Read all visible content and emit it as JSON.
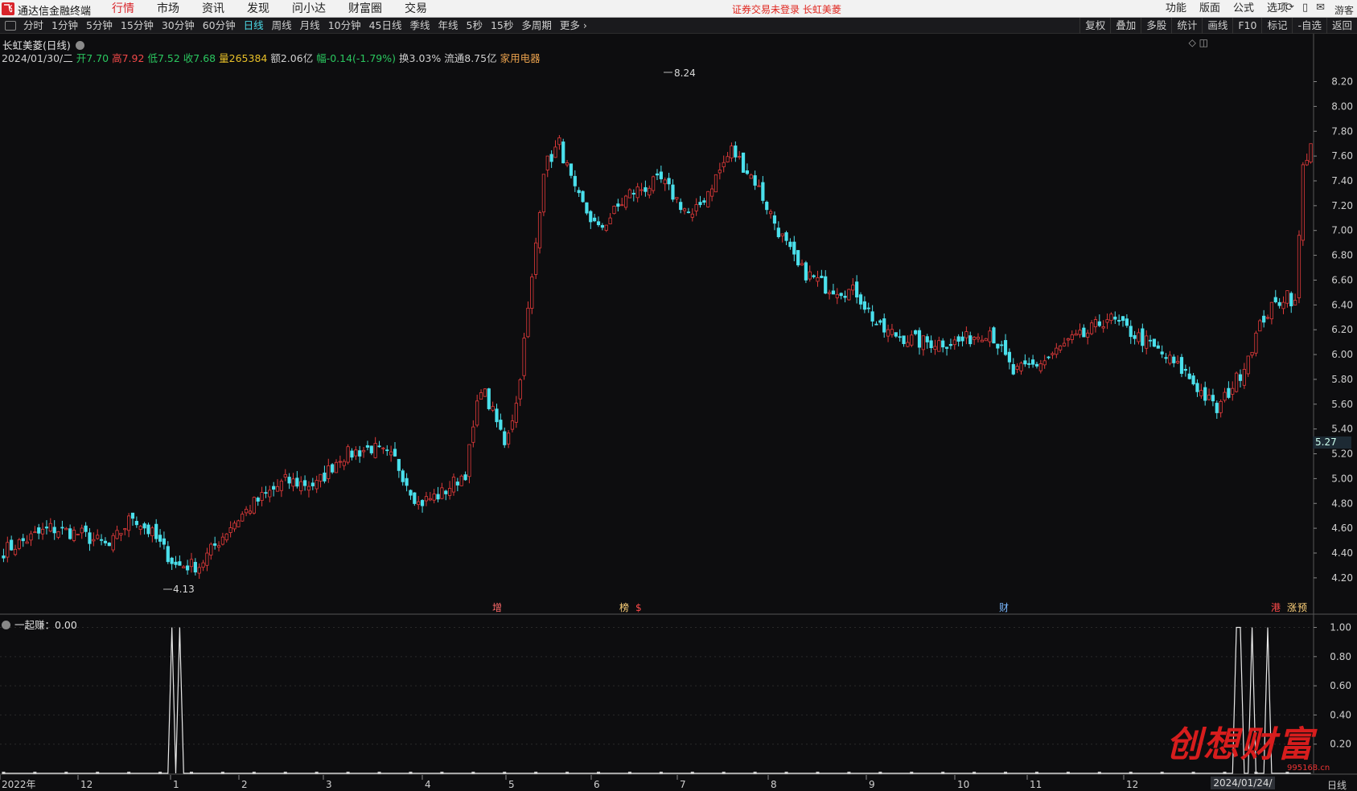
{
  "app": {
    "logo": "飞",
    "title": "通达信金融终端"
  },
  "menu": [
    "行情",
    "市场",
    "资讯",
    "发现",
    "问小达",
    "财富圈",
    "交易"
  ],
  "menu_active_index": 0,
  "notice": "证券交易未登录  长虹美菱",
  "sys_menu": [
    "功能",
    "版面",
    "公式",
    "选项"
  ],
  "sys_icons": [
    "refresh-icon",
    "phone-icon",
    "mail-icon"
  ],
  "guest": "游客",
  "periods": [
    "分时",
    "1分钟",
    "5分钟",
    "15分钟",
    "30分钟",
    "60分钟",
    "日线",
    "周线",
    "月线",
    "10分钟",
    "45日线",
    "季线",
    "年线",
    "5秒",
    "15秒",
    "多周期",
    "更多 ›"
  ],
  "period_active_index": 6,
  "right_tools": [
    "复权",
    "叠加",
    "多股",
    "统计",
    "画线",
    "F10",
    "标记",
    "-自选",
    "返回"
  ],
  "stock": {
    "name": "长虹美菱(日线)"
  },
  "quote": {
    "date": "2024/01/30/二",
    "open_label": "开",
    "open": "7.70",
    "high_label": "高",
    "high": "7.92",
    "low_label": "低",
    "low": "7.52",
    "close_label": "收",
    "close": "7.68",
    "vol_label": "量",
    "vol": "265384",
    "amt_label": "额",
    "amt": "2.06亿",
    "chg_label": "幅",
    "chg": "-0.14(-1.79%)",
    "turn_label": "换",
    "turn": "3.03%",
    "float_label": "流通",
    "float": "8.75亿",
    "industry": "家用电器"
  },
  "current_price_tag": "5.27",
  "indicator": {
    "title": "一起赚：0.00"
  },
  "bottom": {
    "period": "日线",
    "date_box": "2024/01/24/三"
  },
  "watermark": {
    "text": "创想财富",
    "site": "995168.cn"
  },
  "colors": {
    "up": "#e03a3a",
    "down": "#4be0ec",
    "bg": "#0d0d0f"
  },
  "chart_data": {
    "type": "candlestick",
    "price_axis": {
      "ticks": [
        "8.20",
        "8.00",
        "7.80",
        "7.60",
        "7.40",
        "7.20",
        "7.00",
        "6.80",
        "6.60",
        "6.40",
        "6.20",
        "6.00",
        "5.80",
        "5.60",
        "5.40",
        "5.20",
        "5.00",
        "4.80",
        "4.60",
        "4.40",
        "4.20"
      ],
      "ylim": [
        4.05,
        8.32
      ]
    },
    "x_ticks": [
      "2022年",
      "12",
      "1",
      "2",
      "3",
      "4",
      "5",
      "6",
      "7",
      "8",
      "9",
      "10",
      "11",
      "12"
    ],
    "annotations": {
      "max": "8.24",
      "min": "4.13"
    },
    "event_markers": [
      "增",
      "榜",
      "$",
      "财",
      "港",
      "涨",
      "预"
    ],
    "anchors": [
      [
        0,
        4.42
      ],
      [
        12,
        4.6
      ],
      [
        20,
        4.55
      ],
      [
        27,
        4.45
      ],
      [
        33,
        4.7
      ],
      [
        38,
        4.55
      ],
      [
        44,
        4.3
      ],
      [
        50,
        4.3
      ],
      [
        58,
        4.62
      ],
      [
        64,
        4.8
      ],
      [
        72,
        4.98
      ],
      [
        80,
        4.95
      ],
      [
        86,
        5.18
      ],
      [
        94,
        5.25
      ],
      [
        100,
        5.15
      ],
      [
        106,
        4.8
      ],
      [
        112,
        4.88
      ],
      [
        118,
        5.05
      ],
      [
        122,
        5.75
      ],
      [
        128,
        5.3
      ],
      [
        131,
        5.6
      ],
      [
        135,
        6.6
      ],
      [
        138,
        7.5
      ],
      [
        142,
        7.7
      ],
      [
        146,
        7.3
      ],
      [
        152,
        7.0
      ],
      [
        160,
        7.3
      ],
      [
        168,
        7.4
      ],
      [
        176,
        7.1
      ],
      [
        186,
        7.65
      ],
      [
        192,
        7.4
      ],
      [
        198,
        7.0
      ],
      [
        203,
        6.7
      ],
      [
        210,
        6.55
      ],
      [
        218,
        6.5
      ],
      [
        224,
        6.2
      ],
      [
        234,
        6.1
      ],
      [
        244,
        6.1
      ],
      [
        252,
        6.2
      ],
      [
        258,
        5.85
      ],
      [
        266,
        5.95
      ],
      [
        272,
        6.1
      ],
      [
        276,
        6.15
      ],
      [
        282,
        6.3
      ],
      [
        292,
        6.1
      ],
      [
        302,
        5.85
      ],
      [
        310,
        5.55
      ],
      [
        316,
        5.85
      ],
      [
        322,
        6.3
      ],
      [
        328,
        6.5
      ],
      [
        330,
        6.4
      ],
      [
        332,
        7.5
      ],
      [
        334,
        7.72
      ]
    ],
    "indicator_axis": {
      "ticks": [
        "1.00",
        "0.80",
        "0.60",
        "0.40",
        "0.20"
      ],
      "ylim": [
        0,
        1.08
      ]
    },
    "indicator_spikes": [
      43,
      45,
      315,
      316,
      319,
      323
    ]
  }
}
